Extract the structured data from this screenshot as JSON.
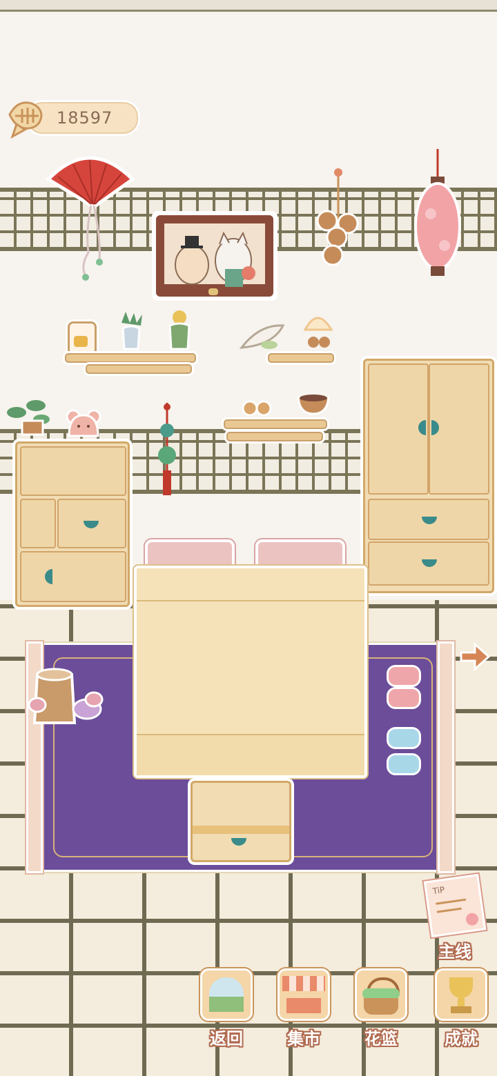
{
  "currency": {
    "value": "18597",
    "icon": "fishbone-icon"
  },
  "nav": {
    "next_arrow": "arrow-right-icon"
  },
  "quest": {
    "label": "主线",
    "icon": "quest-note-icon",
    "note_text": "TiP"
  },
  "bottom_bar": [
    {
      "label": "返回",
      "icon": "window-return-icon"
    },
    {
      "label": "集市",
      "icon": "market-stall-icon"
    },
    {
      "label": "花篮",
      "icon": "flower-basket-icon"
    },
    {
      "label": "成就",
      "icon": "trophy-icon"
    }
  ],
  "colors": {
    "rug": "#6c4d9a",
    "knob": "#3a8b8a",
    "label_outline": "#b06a4f",
    "lantern": "#f2a3a6",
    "fan": "#d6453c"
  }
}
